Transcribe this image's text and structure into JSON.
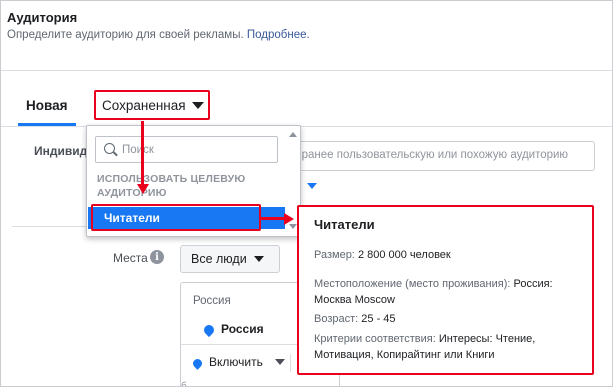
{
  "header": {
    "title": "Аудитория",
    "subtitle": "Определите аудиторию для своей рекламы.",
    "more_link": "Подробнее."
  },
  "tabs": {
    "new_label": "Новая",
    "saved_label": "Сохраненная"
  },
  "form": {
    "individ_label": "Индивид",
    "search_placeholder": "о ранее пользовательскую или похожую аудиторию",
    "places_label": "Места",
    "info_icon": "i",
    "all_people": "Все люди",
    "location_country": "Россия",
    "location_item": "Россия",
    "include_label": "Включить",
    "tiny_text": "б"
  },
  "dropdown": {
    "search_placeholder": "Поиск",
    "section_title": "ИСПОЛЬЗОВАТЬ ЦЕЛЕВУЮ АУДИТОРИЮ",
    "item_label": "Читатели"
  },
  "card": {
    "title": "Читатели",
    "size_label": "Размер:",
    "size_value": "2 800 000 человек",
    "location_label": "Местоположение (место проживания):",
    "location_value": "Россия: Москва Moscow",
    "age_label": "Возраст:",
    "age_value": "25 - 45",
    "criteria_label": "Критерии соответствия:",
    "criteria_value": "Интересы: Чтение, Мотивация, Копирайтинг или Книги"
  },
  "colors": {
    "accent": "#1877f2",
    "annotation_red": "#e8001c",
    "link": "#385898"
  },
  "icons": [
    "search-icon",
    "info-icon",
    "chevron-down-icon",
    "location-pin-icon",
    "arrow-annotation"
  ]
}
